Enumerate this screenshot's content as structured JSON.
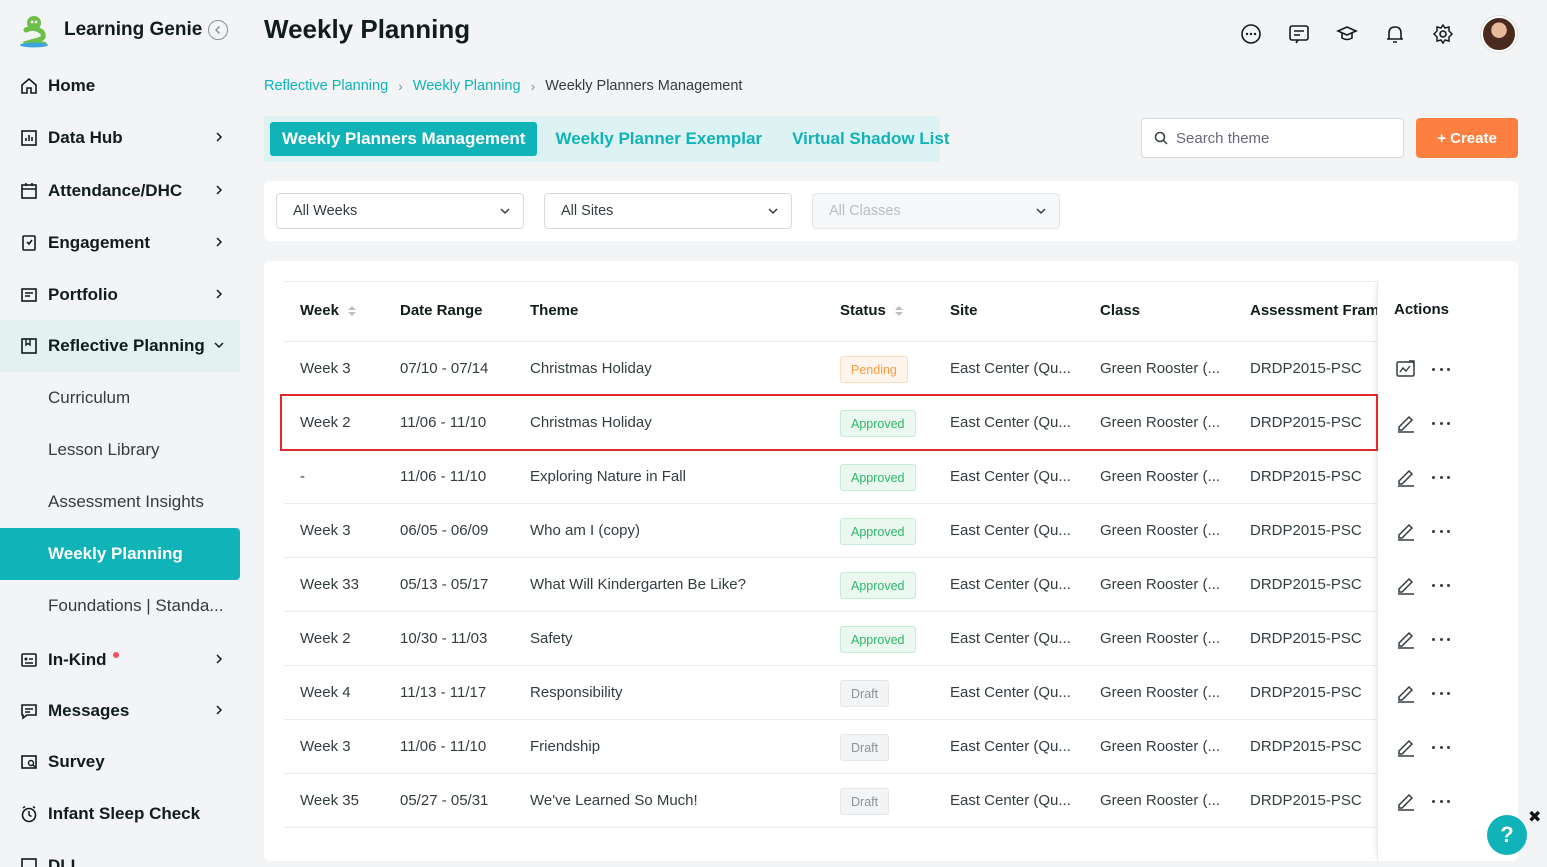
{
  "app": {
    "name": "Learning Genie"
  },
  "sidebar": {
    "items": [
      {
        "label": "Home",
        "icon": "home-icon"
      },
      {
        "label": "Data Hub",
        "icon": "chart-icon"
      },
      {
        "label": "Attendance/DHC",
        "icon": "calendar-icon"
      },
      {
        "label": "Engagement",
        "icon": "engagement-icon"
      },
      {
        "label": "Portfolio",
        "icon": "portfolio-icon"
      },
      {
        "label": "Reflective Planning",
        "icon": "planning-icon"
      },
      {
        "label": "In-Kind",
        "icon": "inkind-icon"
      },
      {
        "label": "Messages",
        "icon": "message-icon"
      },
      {
        "label": "Survey",
        "icon": "survey-icon"
      },
      {
        "label": "Infant Sleep Check",
        "icon": "clock-icon"
      },
      {
        "label": "DLL",
        "icon": "dll-icon"
      }
    ],
    "sub_items": [
      {
        "label": "Curriculum"
      },
      {
        "label": "Lesson Library"
      },
      {
        "label": "Assessment Insights"
      },
      {
        "label": "Weekly Planning"
      },
      {
        "label": "Foundations | Standa..."
      }
    ]
  },
  "header": {
    "title": "Weekly Planning"
  },
  "breadcrumb": [
    "Reflective Planning",
    "Weekly Planning",
    "Weekly Planners Management"
  ],
  "tabs": [
    "Weekly Planners Management",
    "Weekly Planner Exemplar",
    "Virtual Shadow List"
  ],
  "search": {
    "placeholder": "Search theme"
  },
  "create": {
    "label": "+ Create"
  },
  "filters": {
    "weeks": "All Weeks",
    "sites": "All Sites",
    "classes": "All Classes"
  },
  "table": {
    "headers": [
      "Week",
      "Date Range",
      "Theme",
      "Status",
      "Site",
      "Class",
      "Assessment Framework",
      "Actions"
    ],
    "rows": [
      {
        "week": "Week 3",
        "date": "07/10 - 07/14",
        "theme": "Christmas Holiday",
        "status": "Pending",
        "site": "East Center (Qu...",
        "class": "Green Rooster (...",
        "framework": "DRDP2015-PSC"
      },
      {
        "week": "Week 2",
        "date": "11/06 - 11/10",
        "theme": "Christmas Holiday",
        "status": "Approved",
        "site": "East Center (Qu...",
        "class": "Green Rooster (...",
        "framework": "DRDP2015-PSC"
      },
      {
        "week": "-",
        "date": "11/06 - 11/10",
        "theme": "Exploring Nature in Fall",
        "status": "Approved",
        "site": "East Center (Qu...",
        "class": "Green Rooster (...",
        "framework": "DRDP2015-PSC"
      },
      {
        "week": "Week 3",
        "date": "06/05 - 06/09",
        "theme": "Who am I (copy)",
        "status": "Approved",
        "site": "East Center (Qu...",
        "class": "Green Rooster (...",
        "framework": "DRDP2015-PSC"
      },
      {
        "week": "Week 33",
        "date": "05/13 - 05/17",
        "theme": "What Will Kindergarten Be Like?",
        "status": "Approved",
        "site": "East Center (Qu...",
        "class": "Green Rooster (...",
        "framework": "DRDP2015-PSC"
      },
      {
        "week": "Week 2",
        "date": "10/30 - 11/03",
        "theme": "Safety",
        "status": "Approved",
        "site": "East Center (Qu...",
        "class": "Green Rooster (...",
        "framework": "DRDP2015-PSC"
      },
      {
        "week": "Week 4",
        "date": "11/13 - 11/17",
        "theme": "Responsibility",
        "status": "Draft",
        "site": "East Center (Qu...",
        "class": "Green Rooster (...",
        "framework": "DRDP2015-PSC"
      },
      {
        "week": "Week 3",
        "date": "11/06 - 11/10",
        "theme": "Friendship",
        "status": "Draft",
        "site": "East Center (Qu...",
        "class": "Green Rooster (...",
        "framework": "DRDP2015-PSC"
      },
      {
        "week": "Week 35",
        "date": "05/27 - 05/31",
        "theme": "We've Learned So Much!",
        "status": "Draft",
        "site": "East Center (Qu...",
        "class": "Green Rooster (...",
        "framework": "DRDP2015-PSC"
      }
    ]
  },
  "help": {
    "label": "?",
    "close": "✖"
  },
  "colors": {
    "accent": "#10b3b7",
    "create": "#ff7f41",
    "highlight": "#e0282e"
  }
}
